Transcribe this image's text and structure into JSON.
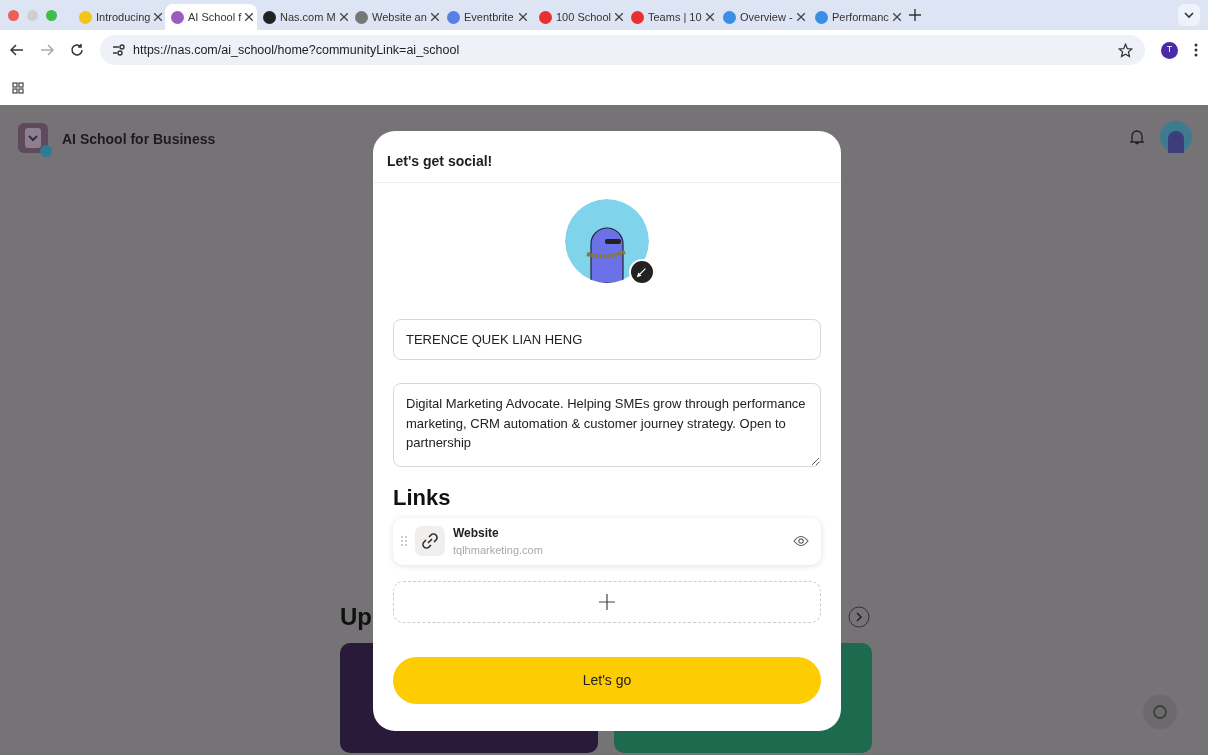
{
  "browser": {
    "tabs": [
      {
        "title": "Introducing",
        "selected": false
      },
      {
        "title": "AI School f",
        "selected": true
      },
      {
        "title": "Nas.com M",
        "selected": false
      },
      {
        "title": "Website an",
        "selected": false
      },
      {
        "title": "Eventbrite",
        "selected": false
      },
      {
        "title": "100 School",
        "selected": false
      },
      {
        "title": "Teams | 10",
        "selected": false
      },
      {
        "title": "Overview -",
        "selected": false
      },
      {
        "title": "Performanc",
        "selected": false
      }
    ],
    "url": "https://nas.com/ai_school/home?communityLink=ai_school",
    "profile_initial": "T"
  },
  "page": {
    "community_name": "AI School for Business",
    "section_title": "Up"
  },
  "modal": {
    "title": "Let's get social!",
    "name": {
      "value": "TERENCE QUEK LIAN HENG"
    },
    "bio": {
      "value": "Digital Marketing Advocate. Helping SMEs grow through performance marketing, CRM automation & customer journey strategy. Open to partnership"
    },
    "links_title": "Links",
    "links": [
      {
        "title": "Website",
        "url": "tqlhmarketing.com",
        "visible": true
      }
    ],
    "submit": "Let's go"
  }
}
